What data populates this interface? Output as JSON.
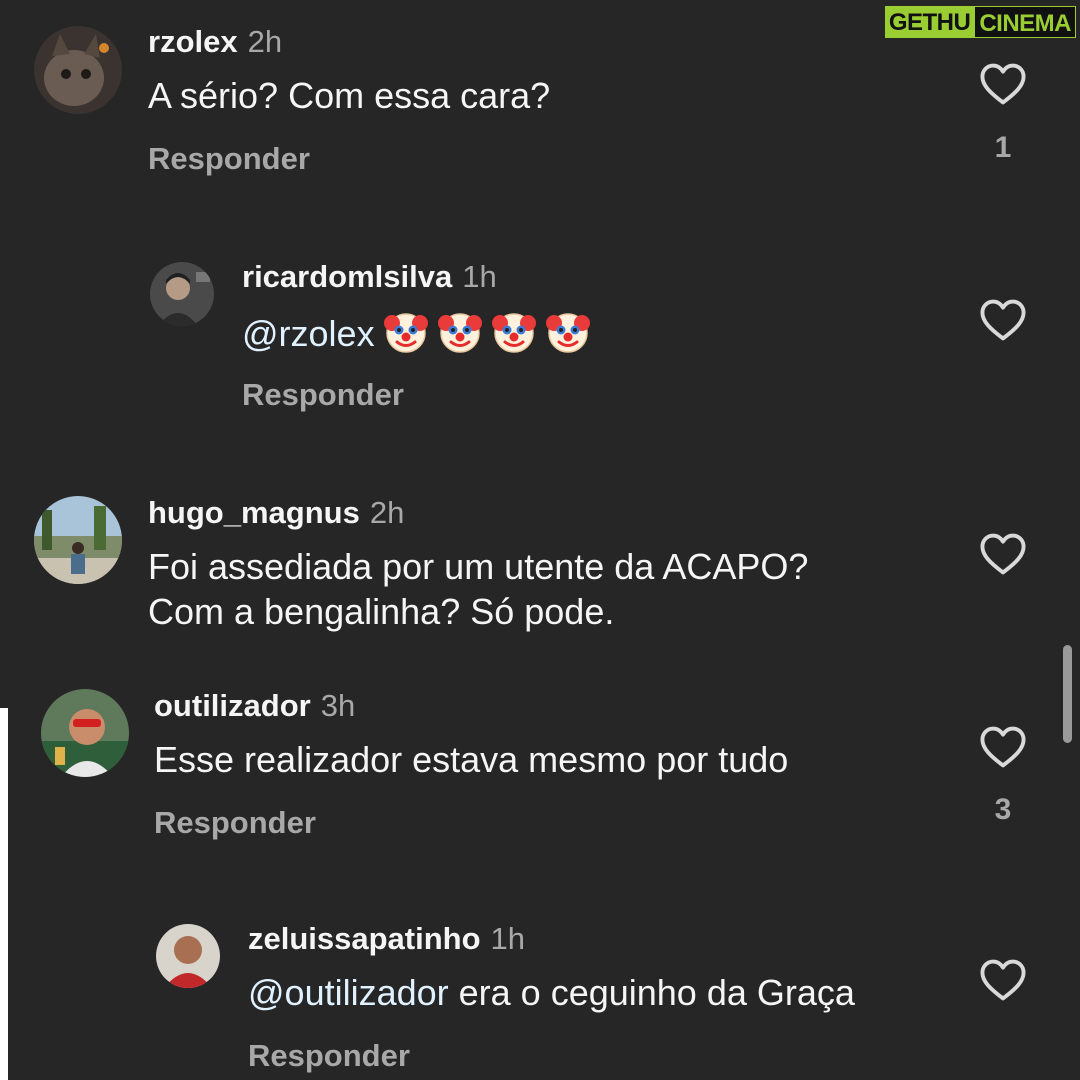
{
  "watermark": {
    "part1": "GETHU",
    "part2": "CINEMA"
  },
  "reply_label": "Responder",
  "colors": {
    "background": "#262626",
    "secondary_text": "#a8a8a8",
    "mention": "#e0f1ff"
  },
  "icons": {
    "like": "heart-outline-icon",
    "emoji": "clown-face-emoji"
  },
  "comments": [
    {
      "username": "rzolex",
      "time": "2h",
      "text": "A sério? Com essa cara?",
      "likes": "1"
    },
    {
      "username": "ricardomlsilva",
      "time": "1h",
      "mention": "@rzolex",
      "emoji_count": 4
    },
    {
      "username": "hugo_magnus",
      "time": "2h",
      "line1": "Foi assediada por um utente da ACAPO?",
      "line2": "Com a bengalinha? Só pode."
    },
    {
      "username": "outilizador",
      "time": "3h",
      "text": "Esse realizador estava mesmo por tudo",
      "likes": "3"
    },
    {
      "username": "zeluissapatinho",
      "time": "1h",
      "mention": "@outilizador",
      "text": " era o ceguinho da Graça"
    }
  ]
}
